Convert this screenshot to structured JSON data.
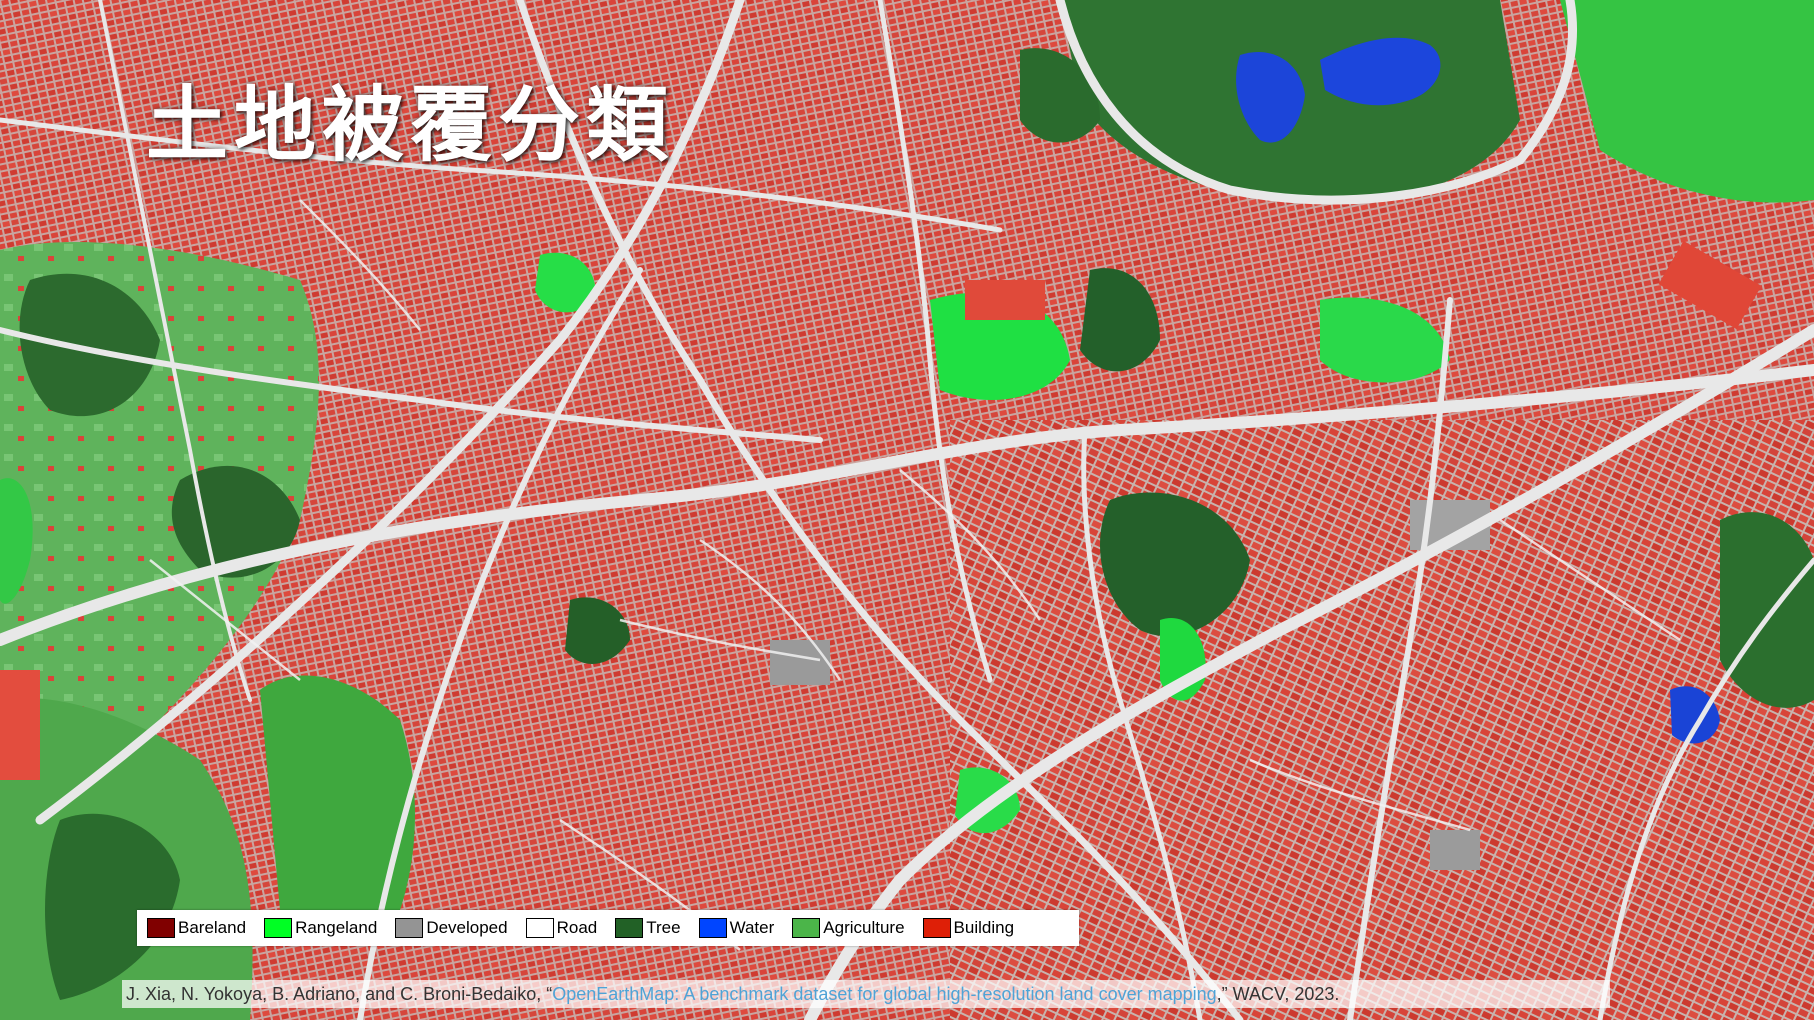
{
  "title": "土地被覆分類",
  "legend": [
    {
      "label": "Bareland",
      "color": "#800000"
    },
    {
      "label": "Rangeland",
      "color": "#00ff24"
    },
    {
      "label": "Developed",
      "color": "#949494"
    },
    {
      "label": "Road",
      "color": "#ffffff"
    },
    {
      "label": "Tree",
      "color": "#226126"
    },
    {
      "label": "Water",
      "color": "#0045ff"
    },
    {
      "label": "Agriculture",
      "color": "#4bb549"
    },
    {
      "label": "Building",
      "color": "#de1f07"
    }
  ],
  "citation": {
    "prefix": "J. Xia, N. Yokoya, B. Adriano, and C. Broni-Bedaiko, “",
    "link": "OpenEarthMap: A benchmark dataset for global high-resolution land cover mapping",
    "suffix": ",” WACV, 2023."
  }
}
